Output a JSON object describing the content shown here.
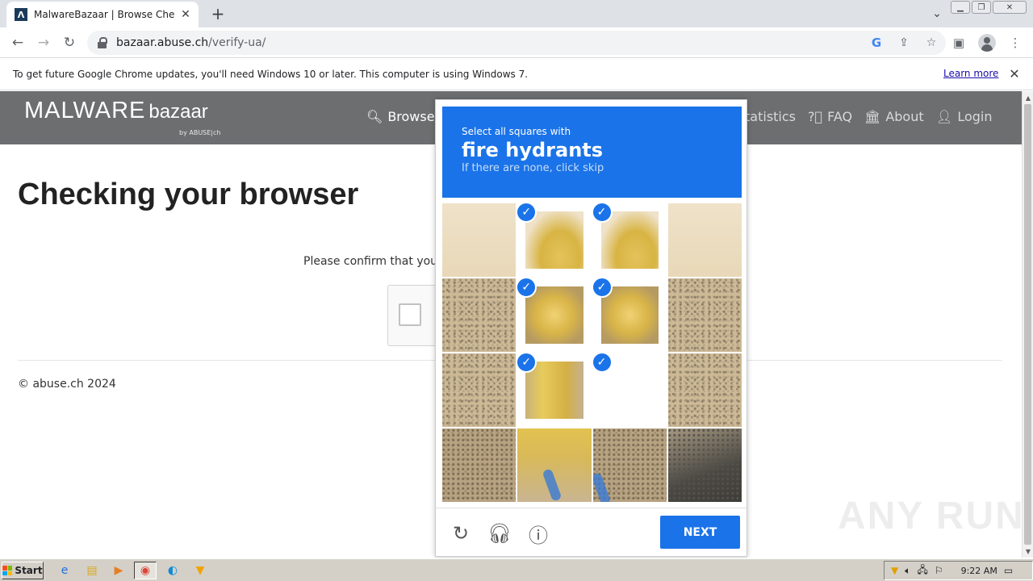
{
  "browser": {
    "tab_title": "MalwareBazaar | Browse Checking y",
    "url_host": "bazaar.abuse.ch",
    "url_path": "/verify-ua/"
  },
  "infobar": {
    "message": "To get future Google Chrome updates, you'll need Windows 10 or later. This computer is using Windows 7.",
    "link": "Learn more"
  },
  "site": {
    "logo_main": "MALWARE",
    "logo_secondary": "bazaar",
    "logo_sub": "by ABUSE|ch",
    "nav": {
      "browse": "Browse",
      "statistics": "Statistics",
      "faq": "FAQ",
      "about": "About",
      "login": "Login"
    }
  },
  "page": {
    "title": "Checking your browser",
    "confirm_text": "Please confirm that you",
    "footer": "© abuse.ch 2024"
  },
  "challenge": {
    "line1": "Select all squares with",
    "line2": "fire hydrants",
    "line3": "If there are none, click skip",
    "next_label": "NEXT",
    "tiles_selected": [
      false,
      true,
      true,
      false,
      false,
      true,
      true,
      false,
      false,
      true,
      true,
      false,
      false,
      false,
      false,
      false
    ]
  },
  "colors": {
    "accent": "#1a73e8",
    "header_bg": "#6c6e70"
  },
  "taskbar": {
    "start_label": "Start",
    "clock": "9:22 AM"
  },
  "watermark": "ANY RUN"
}
